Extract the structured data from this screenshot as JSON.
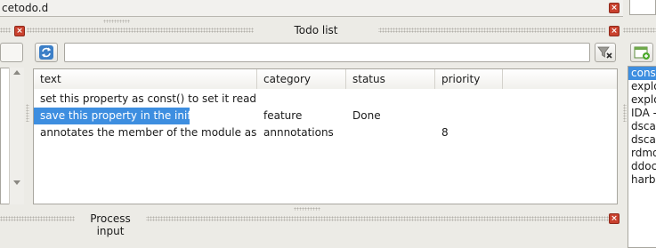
{
  "file_tab": {
    "name": "cetodo.d"
  },
  "todo_panel": {
    "title": "Todo list",
    "search": {
      "value": "",
      "placeholder": ""
    },
    "columns": [
      "text",
      "category",
      "status",
      "priority"
    ],
    "rows": [
      {
        "text": "set this property as const() to set it read only.",
        "category": "",
        "status": "",
        "priority": "",
        "selected": false
      },
      {
        "text": "save this property in the inifile.",
        "category": "feature",
        "status": "Done",
        "priority": "",
        "selected": true
      },
      {
        "text": "annotates the member of the module as @s...",
        "category": "annnotations",
        "status": "",
        "priority": "8",
        "selected": false
      }
    ]
  },
  "process_panel": {
    "title": "Process input"
  },
  "right_list": {
    "items": [
      "conso",
      "explo",
      "explo",
      "IDA -",
      "dscan",
      "dscan",
      "rdmd",
      "ddoc",
      "harbo"
    ],
    "selected_index": 0
  },
  "icons": {
    "close": "close-icon",
    "refresh": "refresh-icon",
    "filter_clear": "filter-clear-icon",
    "add": "add-icon"
  },
  "colors": {
    "selection": "#3d8ee0",
    "close_button": "#c9412e"
  }
}
